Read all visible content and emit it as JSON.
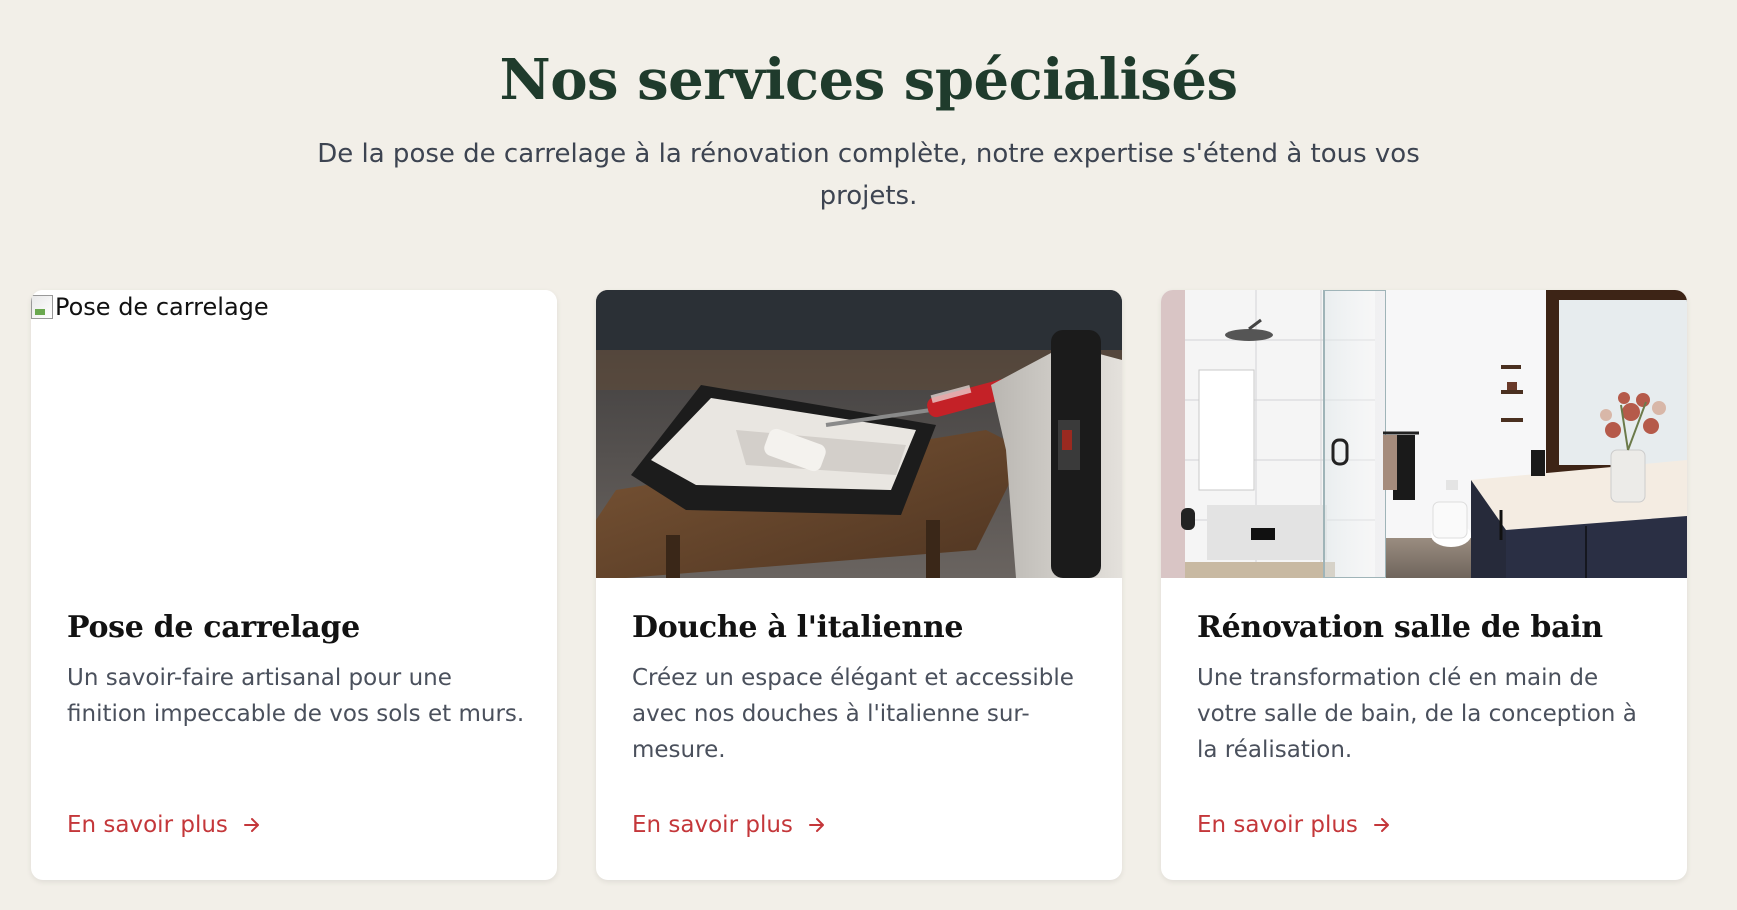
{
  "section": {
    "title": "Nos services spécialisés",
    "subtitle": "De la pose de carrelage à la rénovation complète, notre expertise s'étend à tous vos projets."
  },
  "colors": {
    "background": "#f2efe8",
    "title": "#1f3b2c",
    "link": "#c4373a",
    "card": "#ffffff"
  },
  "cards": [
    {
      "image_alt": "Pose de carrelage",
      "image_icon": "broken-image-icon",
      "title": "Pose de carrelage",
      "description": "Un savoir-faire artisanal pour une finition impeccable de vos sols et murs.",
      "link_label": "En savoir plus",
      "link_icon": "arrow-right-icon"
    },
    {
      "image_alt": "Douche à l'italienne",
      "title": "Douche à l'italienne",
      "description": "Créez un espace élégant et accessible avec nos douches à l'italienne sur-mesure.",
      "link_label": "En savoir plus",
      "link_icon": "arrow-right-icon"
    },
    {
      "image_alt": "Rénovation salle de bain",
      "title": "Rénovation salle de bain",
      "description": "Une transformation clé en main de votre salle de bain, de la conception à la réalisation.",
      "link_label": "En savoir plus",
      "link_icon": "arrow-right-icon"
    }
  ]
}
